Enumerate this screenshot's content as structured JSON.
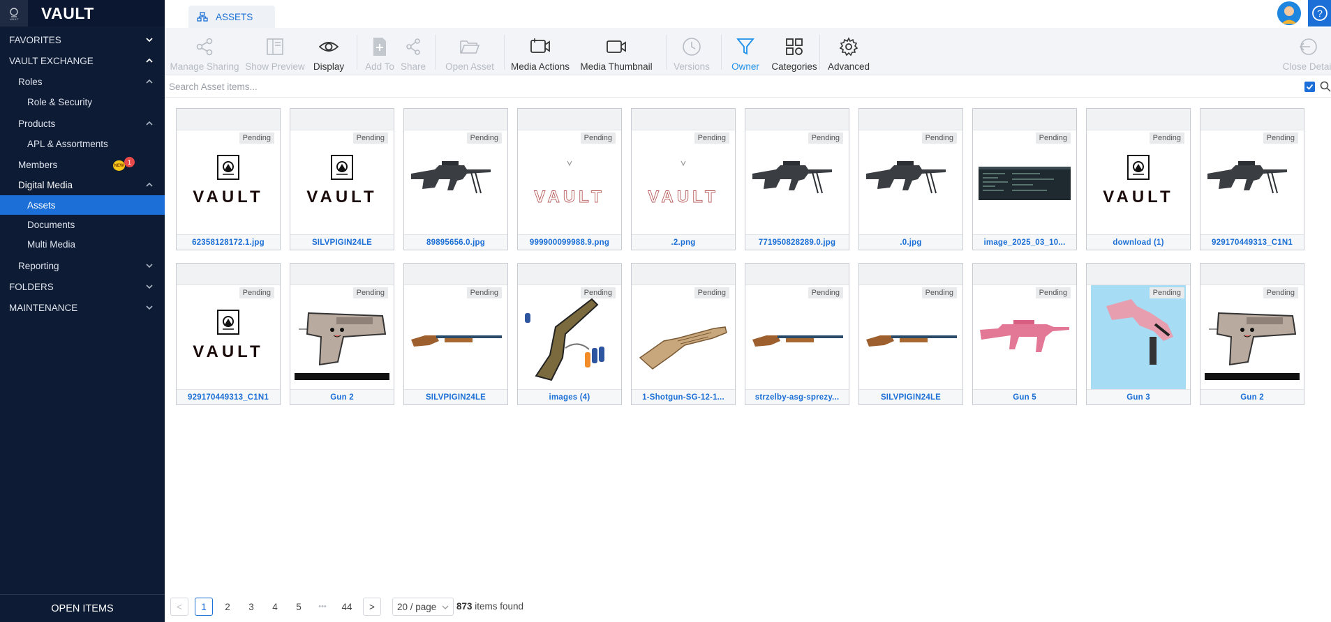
{
  "brand": {
    "title": "VAULT",
    "logo_text": "VAULT"
  },
  "sidebar": {
    "favorites": "FAVORITES",
    "vault_exchange": "VAULT EXCHANGE",
    "roles": "Roles",
    "role_security": "Role & Security",
    "products": "Products",
    "apl_assortments": "APL & Assortments",
    "members": "Members",
    "members_badge_new": "NEW",
    "members_badge_count": "1",
    "digital_media": "Digital Media",
    "assets": "Assets",
    "documents": "Documents",
    "multi_media": "Multi Media",
    "reporting": "Reporting",
    "folders": "FOLDERS",
    "maintenance": "MAINTENANCE",
    "open_items": "OPEN ITEMS"
  },
  "tab": {
    "label": "ASSETS"
  },
  "toolbar": {
    "manage_sharing": "Manage Sharing",
    "show_preview": "Show Preview",
    "display": "Display",
    "add_to": "Add To",
    "share": "Share",
    "open_asset": "Open Asset",
    "media_actions": "Media Actions",
    "media_thumbnail": "Media Thumbnail",
    "versions": "Versions",
    "owner": "Owner",
    "categories": "Categories",
    "advanced": "Advanced",
    "close_detail": "Close Detail"
  },
  "search": {
    "placeholder": "Search Asset items..."
  },
  "status_label": "Pending",
  "assets": [
    {
      "name": "62358128172.1.jpg",
      "thumb": "vault-logo"
    },
    {
      "name": "SILVPIGIN24LE",
      "thumb": "vault-logo"
    },
    {
      "name": "89895656.0.jpg",
      "thumb": "rifle"
    },
    {
      "name": "999900099988.9.png",
      "thumb": "vault-faint"
    },
    {
      "name": ".2.png",
      "thumb": "vault-faint"
    },
    {
      "name": "771950828289.0.jpg",
      "thumb": "rifle"
    },
    {
      "name": ".0.jpg",
      "thumb": "rifle"
    },
    {
      "name": "image_2025_03_10...",
      "thumb": "screen"
    },
    {
      "name": "download (1)",
      "thumb": "vault-logo"
    },
    {
      "name": "929170449313_C1N1",
      "thumb": "rifle"
    },
    {
      "name": "929170449313_C1N1",
      "thumb": "vault-logo"
    },
    {
      "name": "Gun 2",
      "thumb": "cartoon-gun"
    },
    {
      "name": "SILVPIGIN24LE",
      "thumb": "shotgun"
    },
    {
      "name": "images (4)",
      "thumb": "nerf"
    },
    {
      "name": "1-Shotgun-SG-12-1...",
      "thumb": "ornate-shotgun"
    },
    {
      "name": "strzelby-asg-sprezy...",
      "thumb": "shotgun"
    },
    {
      "name": "SILVPIGIN24LE",
      "thumb": "shotgun"
    },
    {
      "name": "Gun 5",
      "thumb": "pink-rifle"
    },
    {
      "name": "Gun 3",
      "thumb": "pink-smg"
    },
    {
      "name": "Gun 2",
      "thumb": "cartoon-gun"
    }
  ],
  "pagination": {
    "prev": "<",
    "next": ">",
    "pages": [
      "1",
      "2",
      "3",
      "4",
      "5"
    ],
    "ellipsis": "•••",
    "last": "44",
    "current": "1",
    "page_size": "20 / page",
    "total_count": "873",
    "found_text": " items found"
  },
  "colors": {
    "sidebar_bg": "#0d1b34",
    "accent": "#1b6fd6",
    "owner_accent": "#1e8fe8"
  }
}
